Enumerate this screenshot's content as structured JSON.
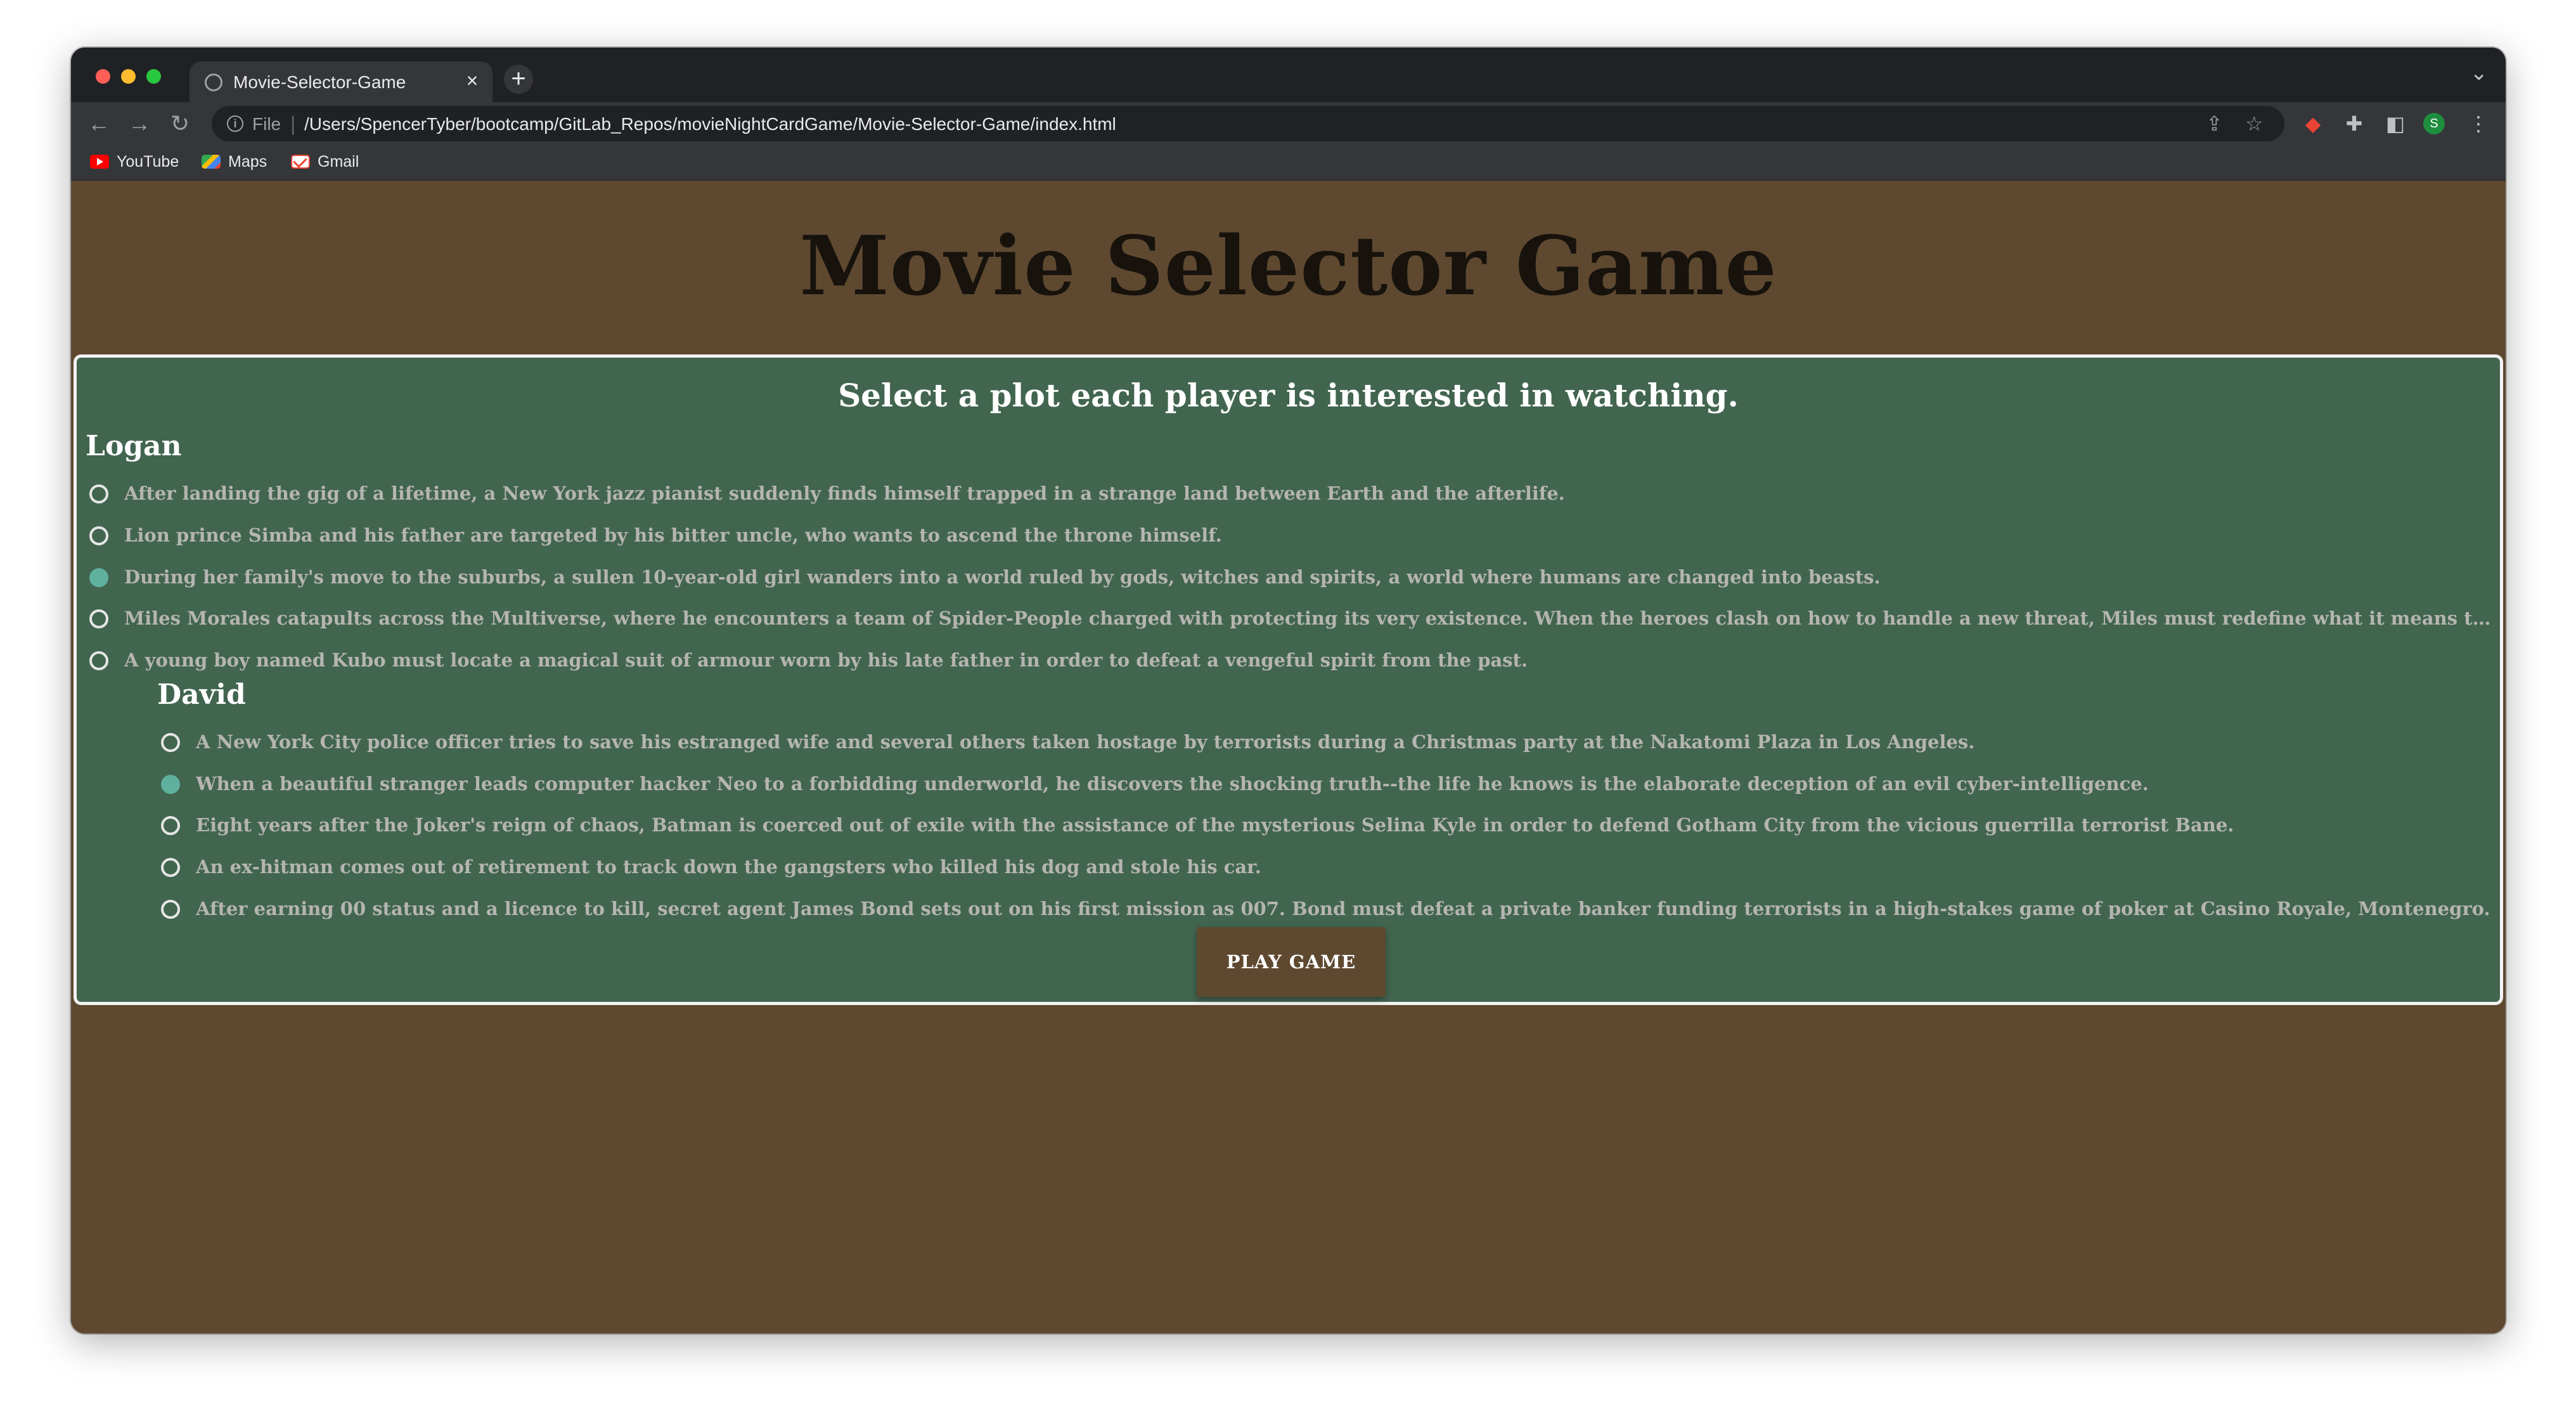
{
  "browser": {
    "tab_title": "Movie-Selector-Game",
    "tab_close": "×",
    "new_tab": "+",
    "tab_menu": "⌄",
    "back": "←",
    "forward": "→",
    "reload": "↻",
    "info_icon": "i",
    "file_label": "File",
    "url_separator": "|",
    "url": "/Users/SpencerTyber/bootcamp/GitLab_Repos/movieNightCardGame/Movie-Selector-Game/index.html",
    "share": "⇪",
    "star": "☆",
    "extension": "◆",
    "puzzle": "✚",
    "sidepanel": "◧",
    "profile_initial": "S",
    "menu": "⋮"
  },
  "bookmarks": [
    {
      "label": "YouTube"
    },
    {
      "label": "Maps"
    },
    {
      "label": "Gmail"
    }
  ],
  "page": {
    "title": "Movie Selector Game",
    "heading": "Select a plot each player is interested in watching.",
    "play_button": "PLAY GAME",
    "colors": {
      "background": "#5e4930",
      "panel": "#426550",
      "panel_border": "#f2f2f2",
      "radio_checked": "#5fb09d",
      "option_text": "#b5b5b1"
    }
  },
  "players": [
    {
      "name": "Logan",
      "selected": 2,
      "options": [
        "After landing the gig of a lifetime, a New York jazz pianist suddenly finds himself trapped in a strange land between Earth and the afterlife.",
        "Lion prince Simba and his father are targeted by his bitter uncle, who wants to ascend the throne himself.",
        "During her family's move to the suburbs, a sullen 10-year-old girl wanders into a world ruled by gods, witches and spirits, a world where humans are changed into beasts.",
        "Miles Morales catapults across the Multiverse, where he encounters a team of Spider-People charged with protecting its very existence. When the heroes clash on how to handle a new threat, Miles must redefine what it means to be a ...",
        "A young boy named Kubo must locate a magical suit of armour worn by his late father in order to defeat a vengeful spirit from the past."
      ]
    },
    {
      "name": "David",
      "selected": 1,
      "options": [
        "A New York City police officer tries to save his estranged wife and several others taken hostage by terrorists during a Christmas party at the Nakatomi Plaza in Los Angeles.",
        "When a beautiful stranger leads computer hacker Neo to a forbidding underworld, he discovers the shocking truth--the life he knows is the elaborate deception of an evil cyber-intelligence.",
        "Eight years after the Joker's reign of chaos, Batman is coerced out of exile with the assistance of the mysterious Selina Kyle in order to defend Gotham City from the vicious guerrilla terrorist Bane.",
        "An ex-hitman comes out of retirement to track down the gangsters who killed his dog and stole his car.",
        "After earning 00 status and a licence to kill, secret agent James Bond sets out on his first mission as 007. Bond must defeat a private banker funding terrorists in a high-stakes game of poker at Casino Royale, Montenegro."
      ]
    }
  ]
}
